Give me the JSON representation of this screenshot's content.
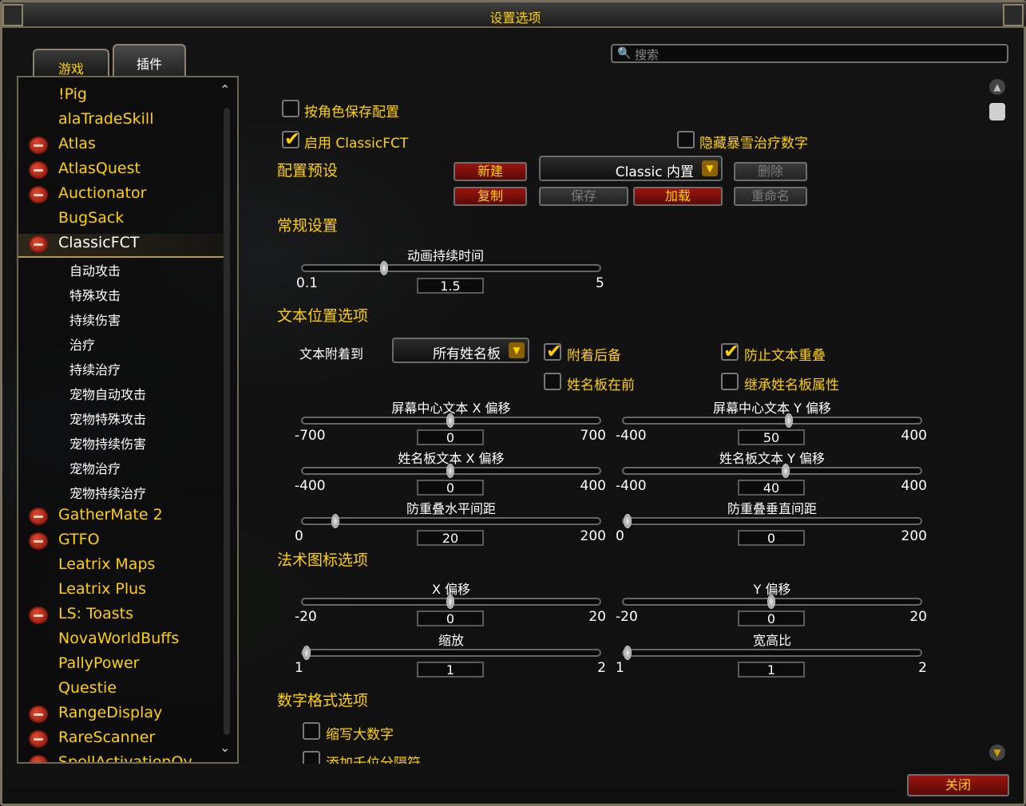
{
  "window": {
    "title": "设置选项"
  },
  "tabs": [
    "游戏",
    "插件"
  ],
  "search": {
    "placeholder": "搜索"
  },
  "sidebar": {
    "items": [
      {
        "label": "!Pig",
        "minus": false
      },
      {
        "label": "alaTradeSkill",
        "minus": false
      },
      {
        "label": "Atlas",
        "minus": true
      },
      {
        "label": "AtlasQuest",
        "minus": true
      },
      {
        "label": "Auctionator",
        "minus": true
      },
      {
        "label": "BugSack",
        "minus": false
      },
      {
        "label": "ClassicFCT",
        "minus": true,
        "selected": true
      }
    ],
    "subitems": [
      "自动攻击",
      "特殊攻击",
      "持续伤害",
      "治疗",
      "持续治疗",
      "宠物自动攻击",
      "宠物特殊攻击",
      "宠物持续伤害",
      "宠物治疗",
      "宠物持续治疗"
    ],
    "items2": [
      {
        "label": "GatherMate 2",
        "minus": true
      },
      {
        "label": "GTFO",
        "minus": true
      },
      {
        "label": "Leatrix Maps",
        "minus": false
      },
      {
        "label": "Leatrix Plus",
        "minus": false
      },
      {
        "label": "LS: Toasts",
        "minus": true
      },
      {
        "label": "NovaWorldBuffs",
        "minus": false
      },
      {
        "label": "PallyPower",
        "minus": false
      },
      {
        "label": "Questie",
        "minus": false
      },
      {
        "label": "RangeDisplay",
        "minus": true
      },
      {
        "label": "RareScanner",
        "minus": true
      },
      {
        "label": "SpellActivationOv",
        "minus": true
      }
    ]
  },
  "main": {
    "save_per_char": "按角色保存配置",
    "enable": "启用 ClassicFCT",
    "hide_crit_heal": "隐藏暴雪治疗数字",
    "preset_header": "配置预设",
    "btn_new": "新建",
    "btn_copy": "复制",
    "btn_save": "保存",
    "btn_load": "加载",
    "btn_delete": "删除",
    "btn_rename": "重命名",
    "preset_value": "Classic 内置",
    "general_header": "常规设置",
    "anim_label": "动画持续时间",
    "anim_min": "0.1",
    "anim_val": "1.5",
    "anim_max": "5",
    "anim_frac": 0.27,
    "textpos_header": "文本位置选项",
    "attach_label": "文本附着到",
    "attach_value": "所有姓名板",
    "cb_attach_fallback": "附着后备",
    "cb_prevent_overlap": "防止文本重叠",
    "cb_nameplate_front": "姓名板在前",
    "cb_inherit": "继承姓名板属性",
    "sliders": [
      {
        "label": "屏幕中心文本 X 偏移",
        "min": "-700",
        "val": "0",
        "max": "700",
        "frac": 0.5
      },
      {
        "label": "屏幕中心文本 Y 偏移",
        "min": "-400",
        "val": "50",
        "max": "400",
        "frac": 0.56
      },
      {
        "label": "姓名板文本 X 偏移",
        "min": "-400",
        "val": "0",
        "max": "400",
        "frac": 0.5
      },
      {
        "label": "姓名板文本 Y 偏移",
        "min": "-400",
        "val": "40",
        "max": "400",
        "frac": 0.55
      },
      {
        "label": "防重叠水平间距",
        "min": "0",
        "val": "20",
        "max": "200",
        "frac": 0.1
      },
      {
        "label": "防重叠垂直间距",
        "min": "0",
        "val": "0",
        "max": "200",
        "frac": 0.0
      }
    ],
    "spell_header": "法术图标选项",
    "sliders2": [
      {
        "label": "X 偏移",
        "min": "-20",
        "val": "0",
        "max": "20",
        "frac": 0.5
      },
      {
        "label": "Y 偏移",
        "min": "-20",
        "val": "0",
        "max": "20",
        "frac": 0.5
      },
      {
        "label": "缩放",
        "min": "1",
        "val": "1",
        "max": "2",
        "frac": 0.0
      },
      {
        "label": "宽高比",
        "min": "1",
        "val": "1",
        "max": "2",
        "frac": 0.0
      }
    ],
    "number_header": "数字格式选项",
    "cb_abbrev": "缩写大数字",
    "cb_thousands": "添加千位分隔符"
  },
  "close": "关闭",
  "colors": {
    "gold": "#ffd100",
    "red_button": "#9b140f",
    "frame": "#7a7260"
  }
}
